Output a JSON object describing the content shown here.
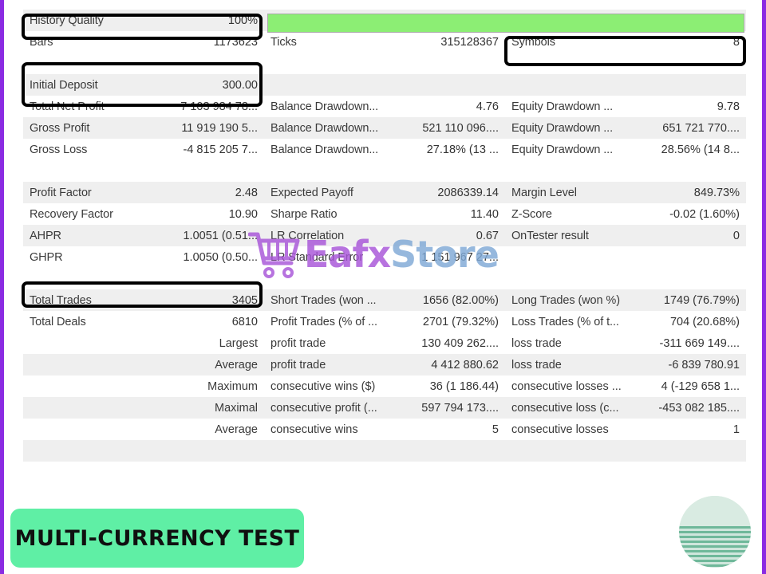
{
  "progress": {
    "percent": 100,
    "fill_color": "#8CEE74",
    "name": "optimization-progress"
  },
  "highlights": [
    "history-quality",
    "initial-deposit-total-net-profit",
    "total-trades",
    "symbols"
  ],
  "report": {
    "sections": [
      {
        "name": "header-section",
        "rows": [
          {
            "shade": "shade",
            "cells": [
              {
                "label": "History Quality",
                "value": "100%"
              },
              {
                "label": "",
                "value": ""
              },
              {
                "label": "",
                "value": ""
              }
            ]
          },
          {
            "shade": "plain",
            "cells": [
              {
                "label": "Bars",
                "value": "1173623"
              },
              {
                "label": "Ticks",
                "value": "315128367"
              },
              {
                "label": "Symbols",
                "value": "8"
              }
            ]
          }
        ]
      },
      {
        "name": "profit-section",
        "rows": [
          {
            "shade": "shade",
            "cells": [
              {
                "label": "Initial Deposit",
                "value": "300.00"
              },
              {
                "label": "",
                "value": ""
              },
              {
                "label": "",
                "value": ""
              }
            ]
          },
          {
            "shade": "plain",
            "cells": [
              {
                "label": "Total Net Profit",
                "value": "7 103 984 78..."
              },
              {
                "label": "Balance Drawdown...",
                "value": "4.76"
              },
              {
                "label": "Equity Drawdown ...",
                "value": "9.78"
              }
            ]
          },
          {
            "shade": "shade",
            "cells": [
              {
                "label": "Gross Profit",
                "value": "11 919 190 5..."
              },
              {
                "label": "Balance Drawdown...",
                "value": "521 110 096...."
              },
              {
                "label": "Equity Drawdown ...",
                "value": "651 721 770...."
              }
            ]
          },
          {
            "shade": "plain",
            "cells": [
              {
                "label": "Gross Loss",
                "value": "-4 815 205 7..."
              },
              {
                "label": "Balance Drawdown...",
                "value": "27.18% (13 ..."
              },
              {
                "label": "Equity Drawdown ...",
                "value": "28.56% (14 8..."
              }
            ]
          }
        ]
      },
      {
        "name": "ratios-section",
        "rows": [
          {
            "shade": "shade",
            "cells": [
              {
                "label": "Profit Factor",
                "value": "2.48"
              },
              {
                "label": "Expected Payoff",
                "value": "2086339.14"
              },
              {
                "label": "Margin Level",
                "value": "849.73%"
              }
            ]
          },
          {
            "shade": "plain",
            "cells": [
              {
                "label": "Recovery Factor",
                "value": "10.90"
              },
              {
                "label": "Sharpe Ratio",
                "value": "11.40"
              },
              {
                "label": "Z-Score",
                "value": "-0.02 (1.60%)"
              }
            ]
          },
          {
            "shade": "shade",
            "cells": [
              {
                "label": "AHPR",
                "value": "1.0051 (0.51..."
              },
              {
                "label": "LR Correlation",
                "value": "0.67"
              },
              {
                "label": "OnTester result",
                "value": "0"
              }
            ]
          },
          {
            "shade": "plain",
            "cells": [
              {
                "label": "GHPR",
                "value": "1.0050 (0.50..."
              },
              {
                "label": "LR Standard Error",
                "value": "1 151 967 27..."
              },
              {
                "label": "",
                "value": ""
              }
            ]
          }
        ]
      },
      {
        "name": "trades-section",
        "rows": [
          {
            "shade": "shade",
            "cells": [
              {
                "label": "Total Trades",
                "value": "3405"
              },
              {
                "label": "Short Trades (won ...",
                "value": "1656 (82.00%)"
              },
              {
                "label": "Long Trades (won %)",
                "value": "1749 (76.79%)"
              }
            ]
          },
          {
            "shade": "plain",
            "cells": [
              {
                "label": "Total Deals",
                "value": "6810"
              },
              {
                "label": "Profit Trades (% of ...",
                "value": "2701 (79.32%)"
              },
              {
                "label": "Loss Trades (% of t...",
                "value": "704 (20.68%)"
              }
            ]
          }
        ]
      }
    ],
    "extremes": {
      "name": "extremes-section",
      "rows": [
        {
          "shade": "plain",
          "keyword": "Largest",
          "mid_phrase": "profit trade",
          "mid_value": "130 409 262....",
          "right_phrase": "loss trade",
          "right_value": "-311 669 149...."
        },
        {
          "shade": "shade",
          "keyword": "Average",
          "mid_phrase": "profit trade",
          "mid_value": "4 412 880.62",
          "right_phrase": "loss trade",
          "right_value": "-6 839 780.91"
        },
        {
          "shade": "plain",
          "keyword": "Maximum",
          "mid_phrase": "consecutive wins ($)",
          "mid_value": "36 (1 186.44)",
          "right_phrase": "consecutive losses ...",
          "right_value": "4 (-129 658 1..."
        },
        {
          "shade": "shade",
          "keyword": "Maximal",
          "mid_phrase": "consecutive profit (...",
          "mid_value": "597 794 173....",
          "right_phrase": "consecutive loss (c...",
          "right_value": "-453 082 185...."
        },
        {
          "shade": "plain",
          "keyword": "Average",
          "mid_phrase": "consecutive wins",
          "mid_value": "5",
          "right_phrase": "consecutive losses",
          "right_value": "1"
        }
      ]
    }
  },
  "watermark": {
    "brand_first": "Eafx",
    "brand_second": "Store",
    "cart_icon": "shopping-cart-icon",
    "color_first": "#A855D8",
    "color_second": "#7FA9D6"
  },
  "banner": {
    "text": "MULTI-CURRENCY TEST",
    "bg_color": "#5FEFA5"
  },
  "decoration": {
    "circle": "circle-gradient-decoration"
  }
}
